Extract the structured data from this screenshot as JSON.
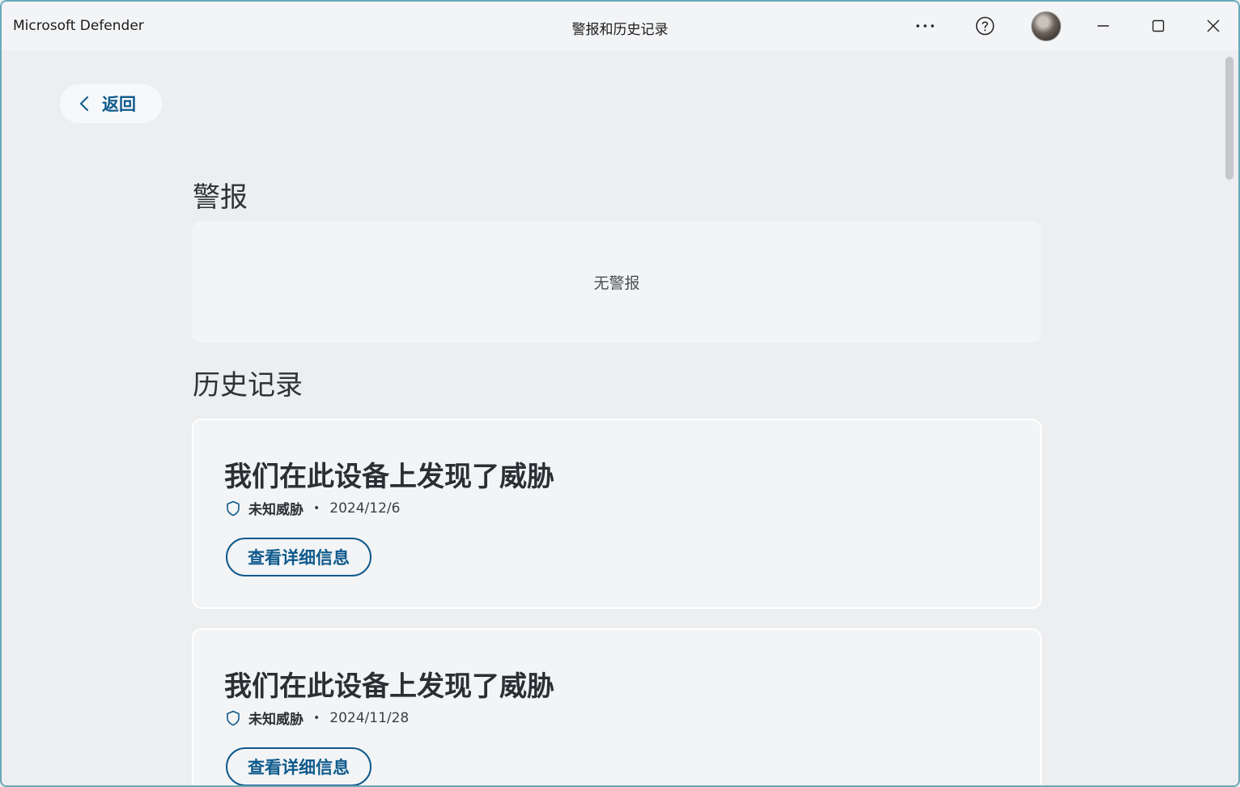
{
  "titlebar": {
    "app_title": "Microsoft Defender",
    "window_title": "警报和历史记录"
  },
  "nav": {
    "back_label": "返回"
  },
  "alerts": {
    "heading": "警报",
    "empty_text": "无警报"
  },
  "history": {
    "heading": "历史记录",
    "items": [
      {
        "title": "我们在此设备上发现了威胁",
        "kind": "未知威胁",
        "date": "2024/12/6",
        "button_label": "查看详细信息"
      },
      {
        "title": "我们在此设备上发现了威胁",
        "kind": "未知威胁",
        "date": "2024/11/28",
        "button_label": "查看详细信息"
      }
    ]
  },
  "colors": {
    "accent": "#0f5a8c",
    "background": "#eceef0",
    "card": "#f3f4f6"
  },
  "icons": {
    "more": "more-icon",
    "help": "help-icon",
    "minimize": "minimize-icon",
    "maximize": "maximize-icon",
    "close": "close-icon",
    "back": "chevron-left-icon",
    "threat": "shield-icon"
  }
}
